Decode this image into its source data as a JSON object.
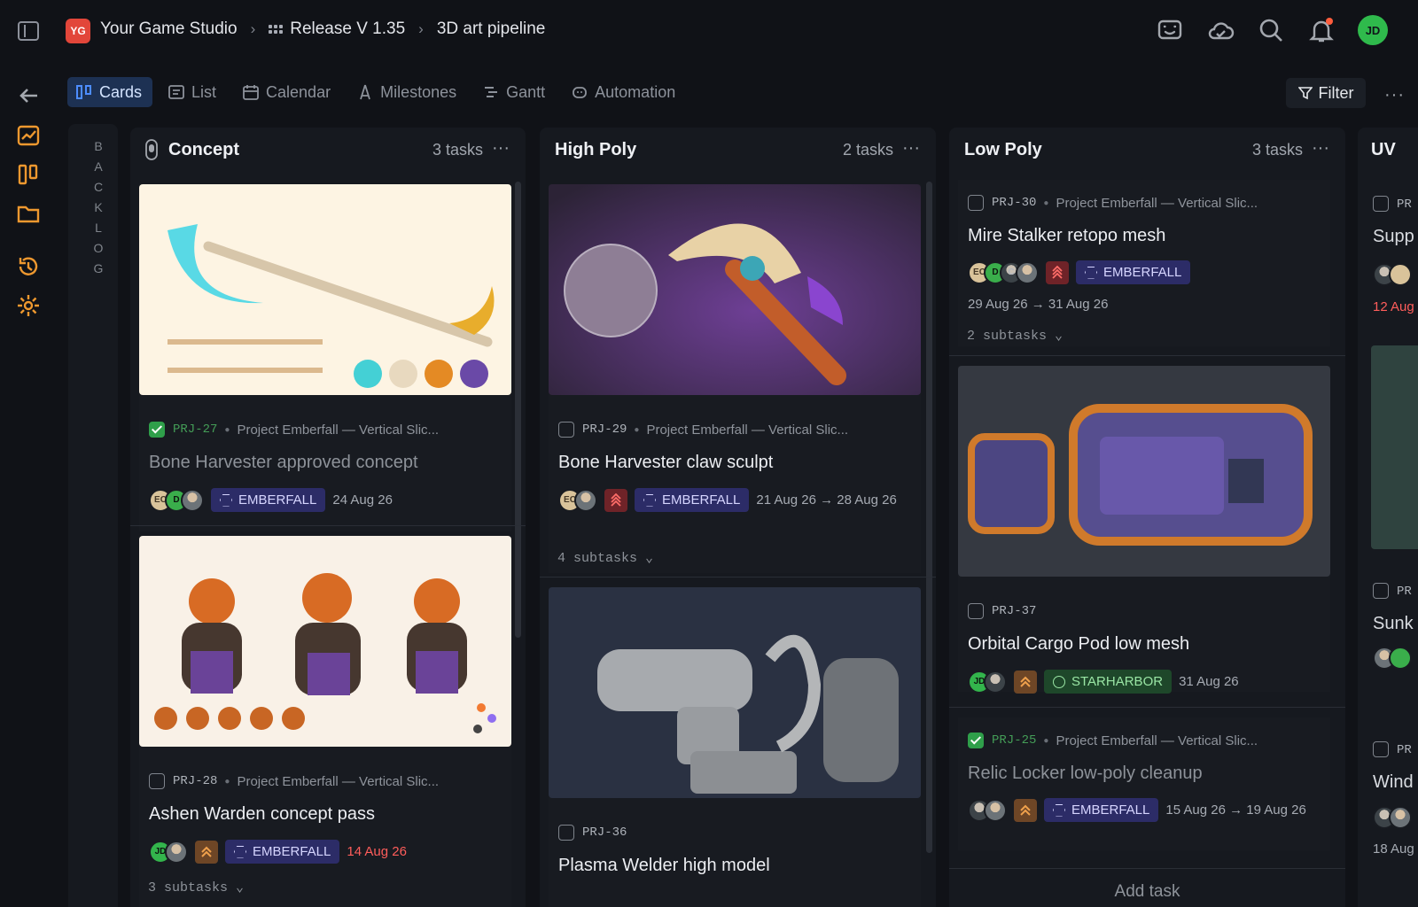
{
  "breadcrumb": {
    "studio": "Your Game Studio",
    "release": "Release V 1.35",
    "pipeline": "3D art pipeline",
    "logo": "YG"
  },
  "top_icons": [
    "message-icon",
    "cloud-check-icon",
    "search-icon",
    "bell-icon"
  ],
  "user": {
    "initials": "JD"
  },
  "views": [
    "Cards",
    "List",
    "Calendar",
    "Milestones",
    "Gantt",
    "Automation"
  ],
  "filter": "Filter",
  "more": "···",
  "backlog": "BACKLOG",
  "columns": [
    {
      "name": "Concept",
      "count": "3 tasks"
    },
    {
      "name": "High Poly",
      "count": "2 tasks"
    },
    {
      "name": "Low Poly",
      "count": "3 tasks"
    },
    {
      "name": "UV"
    }
  ],
  "project_name": "Project Emberfall — Vertical Slic...",
  "cards": {
    "c1": {
      "key": "PRJ-27",
      "title": "Bone Harvester approved concept",
      "tag": "EMBERFALL",
      "date": "24 Aug 26",
      "avatars": [
        "EC",
        "D"
      ]
    },
    "c2": {
      "key": "PRJ-28",
      "title": "Ashen Warden concept pass",
      "tag": "EMBERFALL",
      "date": "14 Aug 26",
      "subtasks": "3 subtasks",
      "avatars": [
        "JD"
      ]
    },
    "h1": {
      "key": "PRJ-29",
      "title": "Bone Harvester claw sculpt",
      "tag": "EMBERFALL",
      "date": "21 Aug 26 → 28 Aug 26",
      "subtasks": "4 subtasks",
      "avatars": [
        "EC"
      ]
    },
    "h2": {
      "key": "PRJ-36",
      "title": "Plasma Welder high model"
    },
    "l1": {
      "key": "PRJ-30",
      "title": "Mire Stalker retopo mesh",
      "tag": "EMBERFALL",
      "date": "29 Aug 26 → 31 Aug 26",
      "subtasks": "2 subtasks",
      "avatars": [
        "EC",
        "D",
        "C"
      ]
    },
    "l2": {
      "key": "PRJ-37",
      "title": "Orbital Cargo Pod low mesh",
      "tag": "STARHARBOR",
      "date": "31 Aug 26",
      "avatars": [
        "JD"
      ]
    },
    "l3": {
      "key": "PRJ-25",
      "title": "Relic Locker low-poly cleanup",
      "tag": "EMBERFALL",
      "date": "15 Aug 26 → 19 Aug 26"
    }
  },
  "add_task": "Add task",
  "uv": {
    "key": "PR",
    "row1": "Supp",
    "date1": "12 Aug",
    "row2": "Sunk",
    "row3": "Wind",
    "date3": "18 Aug"
  },
  "colors": {
    "accent": "#2f6fe8",
    "red": "#e2463a",
    "green": "#2fba4c",
    "purple": "#2c2c67"
  }
}
